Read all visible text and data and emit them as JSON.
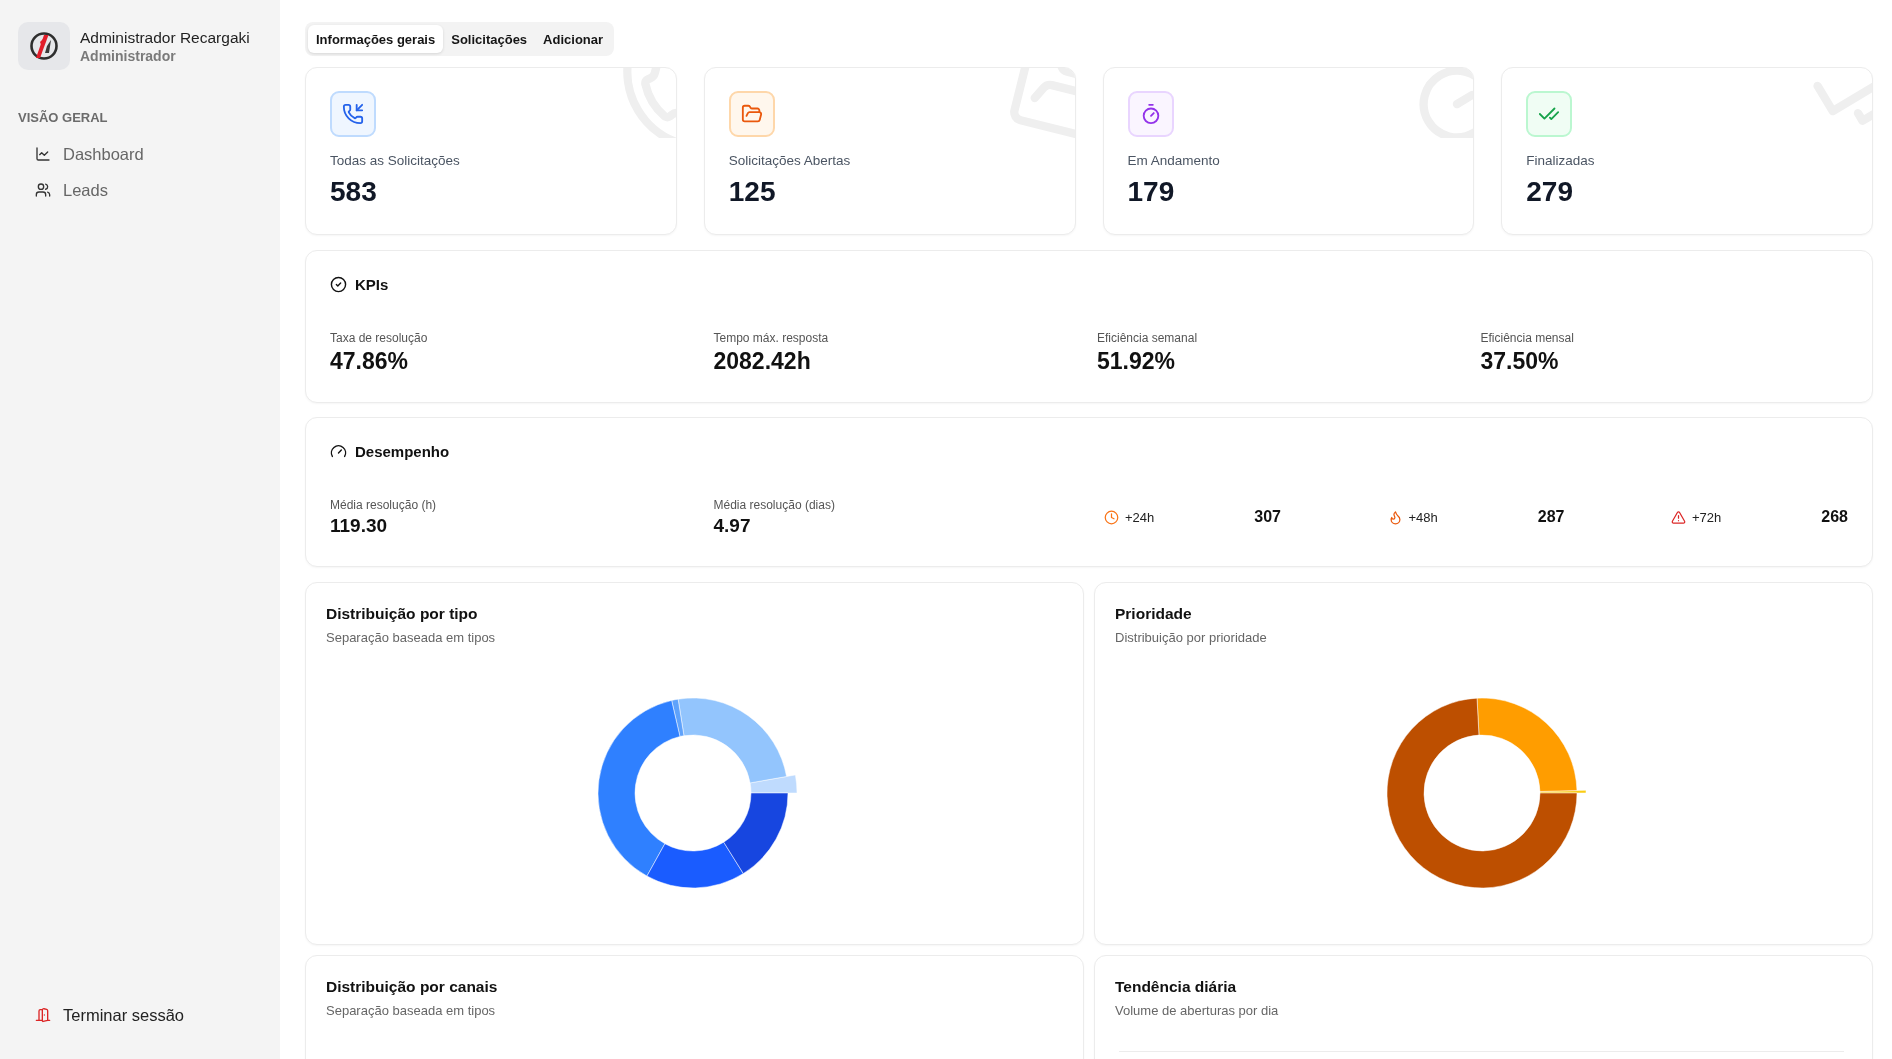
{
  "sidebar": {
    "user": {
      "name": "Administrador Recargaki",
      "role": "Administrador"
    },
    "section_title": "VISÃO GERAL",
    "items": [
      {
        "kind": "dashboard",
        "label": "Dashboard",
        "selected": false
      },
      {
        "kind": "leads",
        "label": "Leads",
        "selected": false
      }
    ],
    "logout": "Terminar sessão"
  },
  "tabs": [
    {
      "label": "Informações gerais",
      "selected": true
    },
    {
      "label": "Solicitações",
      "selected": false
    },
    {
      "label": "Adicionar",
      "selected": false
    }
  ],
  "stat_cards": [
    {
      "kind": "phone",
      "label": "Todas as Solicitações",
      "value": "583"
    },
    {
      "kind": "folder",
      "label": "Solicitações Abertas",
      "value": "125"
    },
    {
      "kind": "timer",
      "label": "Em Andamento",
      "value": "179"
    },
    {
      "kind": "done",
      "label": "Finalizadas",
      "value": "279"
    }
  ],
  "kpis": {
    "title": "KPIs",
    "metrics": [
      {
        "label": "Taxa de resolução",
        "value": "47.86%"
      },
      {
        "label": "Tempo máx. resposta",
        "value": "2082.42h"
      },
      {
        "label": "Eficiência semanal",
        "value": "51.92%"
      },
      {
        "label": "Eficiência mensal",
        "value": "37.50%"
      }
    ]
  },
  "performance": {
    "title": "Desempenho",
    "metrics": [
      {
        "label": "Média resolução (h)",
        "value": "119.30"
      },
      {
        "label": "Média resolução (dias)",
        "value": "4.97"
      }
    ],
    "alerts": [
      {
        "kind": "clock",
        "label": "+24h",
        "value": "307"
      },
      {
        "kind": "flame",
        "label": "+48h",
        "value": "287"
      },
      {
        "kind": "warning",
        "label": "+72h",
        "value": "268"
      }
    ]
  },
  "chart_cards": [
    {
      "kind": "types",
      "title": "Distribuição por tipo",
      "subtitle": "Separação baseada em tipos"
    },
    {
      "kind": "priority",
      "title": "Prioridade",
      "subtitle": "Distribuição por prioridade"
    },
    {
      "kind": "channels",
      "title": "Distribuição por canais",
      "subtitle": "Separação baseada em tipos"
    },
    {
      "kind": "trend",
      "title": "Tendência diária",
      "subtitle": "Volume de aberturas por dia"
    }
  ]
}
